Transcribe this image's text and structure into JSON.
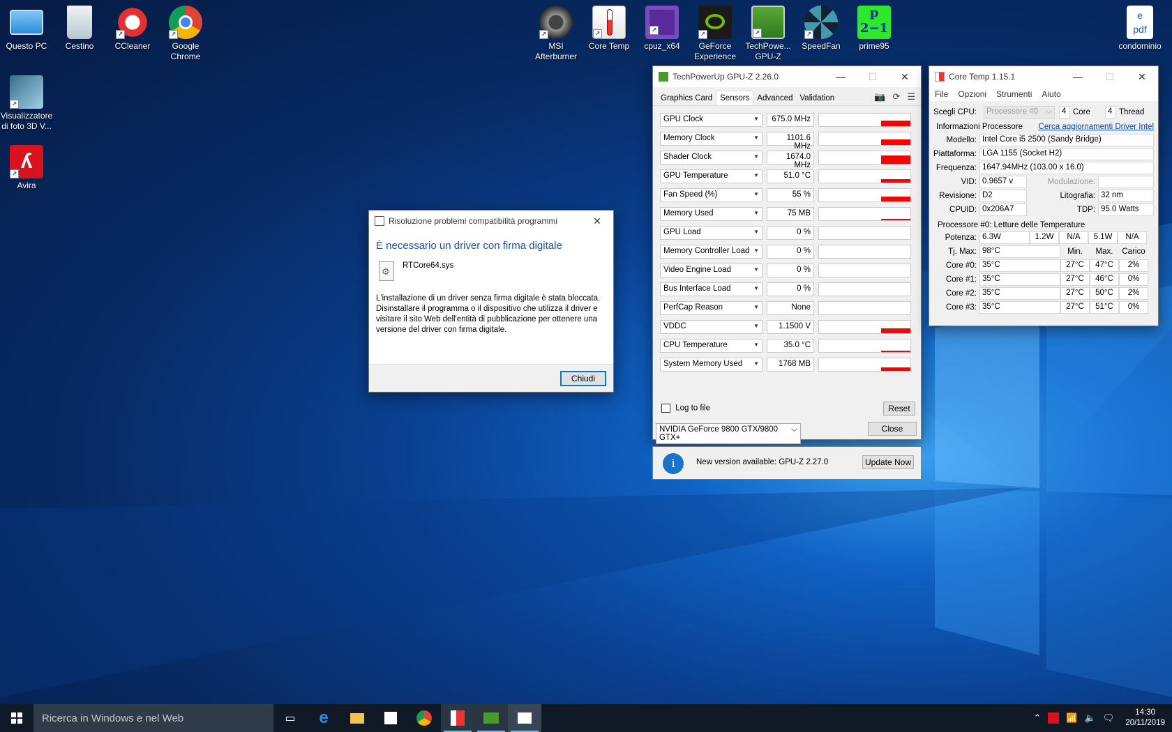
{
  "desktop": {
    "icons_left": [
      {
        "label": "Questo PC"
      },
      {
        "label": "Cestino"
      },
      {
        "label": "CCleaner"
      },
      {
        "label": "Google Chrome"
      },
      {
        "label": "Visualizzatore di foto 3D V..."
      },
      {
        "label": "Avira"
      }
    ],
    "icons_top": [
      {
        "label": "MSI Afterburner"
      },
      {
        "label": "Core Temp"
      },
      {
        "label": "cpuz_x64"
      },
      {
        "label": "GeForce Experience"
      },
      {
        "label": "TechPowe... GPU-Z"
      },
      {
        "label": "SpeedFan"
      },
      {
        "label": "prime95"
      }
    ],
    "icon_right": {
      "label": "condominio"
    }
  },
  "dialog": {
    "title": "Risoluzione problemi compatibilità programmi",
    "heading": "È necessario un driver con firma digitale",
    "file_name": "RTCore64.sys",
    "message": "L'installazione di un driver senza firma digitale è stata bloccata. Disinstallare il programma o il dispositivo che utilizza il driver e visitare il sito Web dell'entità di pubblicazione per ottenere una versione del driver con firma digitale.",
    "close_label": "Chiudi"
  },
  "gpuz": {
    "title": "TechPowerUp GPU-Z 2.26.0",
    "tabs": [
      "Graphics Card",
      "Sensors",
      "Advanced",
      "Validation"
    ],
    "active_tab": "Sensors",
    "sensors": [
      {
        "name": "GPU Clock",
        "value": "675.0 MHz",
        "level": 0.45
      },
      {
        "name": "Memory Clock",
        "value": "1101.6 MHz",
        "level": 0.45
      },
      {
        "name": "Shader Clock",
        "value": "1674.0 MHz",
        "level": 0.65
      },
      {
        "name": "GPU Temperature",
        "value": "51.0 °C",
        "level": 0.3
      },
      {
        "name": "Fan Speed (%)",
        "value": "55 %",
        "level": 0.4
      },
      {
        "name": "Memory Used",
        "value": "75 MB",
        "level": 0.1
      },
      {
        "name": "GPU Load",
        "value": "0 %",
        "level": 0
      },
      {
        "name": "Memory Controller Load",
        "value": "0 %",
        "level": 0
      },
      {
        "name": "Video Engine Load",
        "value": "0 %",
        "level": 0
      },
      {
        "name": "Bus Interface Load",
        "value": "0 %",
        "level": 0
      },
      {
        "name": "PerfCap Reason",
        "value": "None",
        "level": 0
      },
      {
        "name": "VDDC",
        "value": "1.1500 V",
        "level": 0.4
      },
      {
        "name": "CPU Temperature",
        "value": "35.0 °C",
        "level": 0.12
      },
      {
        "name": "System Memory Used",
        "value": "1768 MB",
        "level": 0.3
      }
    ],
    "log_to_file": "Log to file",
    "reset": "Reset",
    "gpu_select": "NVIDIA GeForce 9800 GTX/9800 GTX+",
    "close": "Close",
    "update_message": "New version available: GPU-Z 2.27.0",
    "update_button": "Update Now",
    "graph_color": "#ff0000"
  },
  "coretemp": {
    "title": "Core Temp 1.15.1",
    "menu": [
      "File",
      "Opzioni",
      "Strumenti",
      "Aiuto"
    ],
    "select_cpu_label": "Scegli CPU:",
    "cpu_select": "Processore #0",
    "core_count": "4",
    "core_label": "Core",
    "thread_count": "4",
    "thread_label": "Thread",
    "info_title": "Informazioni Processore",
    "driver_link": "Cerca aggiornamenti Driver Intel",
    "modello_label": "Modello:",
    "modello": "Intel Core i5 2500 (Sandy Bridge)",
    "piattaforma_label": "Piattaforma:",
    "piattaforma": "LGA 1155 (Socket H2)",
    "frequenza_label": "Frequenza:",
    "frequenza": "1647.94MHz (103.00 x 16.0)",
    "vid_label": "VID:",
    "vid": "0.9657 v",
    "modulazione_label": "Modulazione:",
    "modulazione": "",
    "revisione_label": "Revisione:",
    "revisione": "D2",
    "litografia_label": "Litografia:",
    "litografia": "32 nm",
    "cpuid_label": "CPUID:",
    "cpuid": "0x206A7",
    "tdp_label": "TDP:",
    "tdp": "95.0 Watts",
    "temps_title": "Processore #0: Letture delle Temperature",
    "potenza_label": "Potenza:",
    "potenza": [
      "6.3W",
      "1.2W",
      "N/A",
      "5.1W",
      "N/A"
    ],
    "tjmax_label": "Tj. Max:",
    "tjmax": "98°C",
    "col_headers": [
      "Min.",
      "Max.",
      "Carico"
    ],
    "cores": [
      {
        "label": "Core #0:",
        "temp": "35°C",
        "min": "27°C",
        "max": "47°C",
        "load": "2%"
      },
      {
        "label": "Core #1:",
        "temp": "35°C",
        "min": "27°C",
        "max": "46°C",
        "load": "0%"
      },
      {
        "label": "Core #2:",
        "temp": "35°C",
        "min": "27°C",
        "max": "50°C",
        "load": "2%"
      },
      {
        "label": "Core #3:",
        "temp": "35°C",
        "min": "27°C",
        "max": "51°C",
        "load": "0%"
      }
    ]
  },
  "taskbar": {
    "search_placeholder": "Ricerca in Windows e nel Web",
    "time": "14:30",
    "date": "20/11/2019"
  }
}
